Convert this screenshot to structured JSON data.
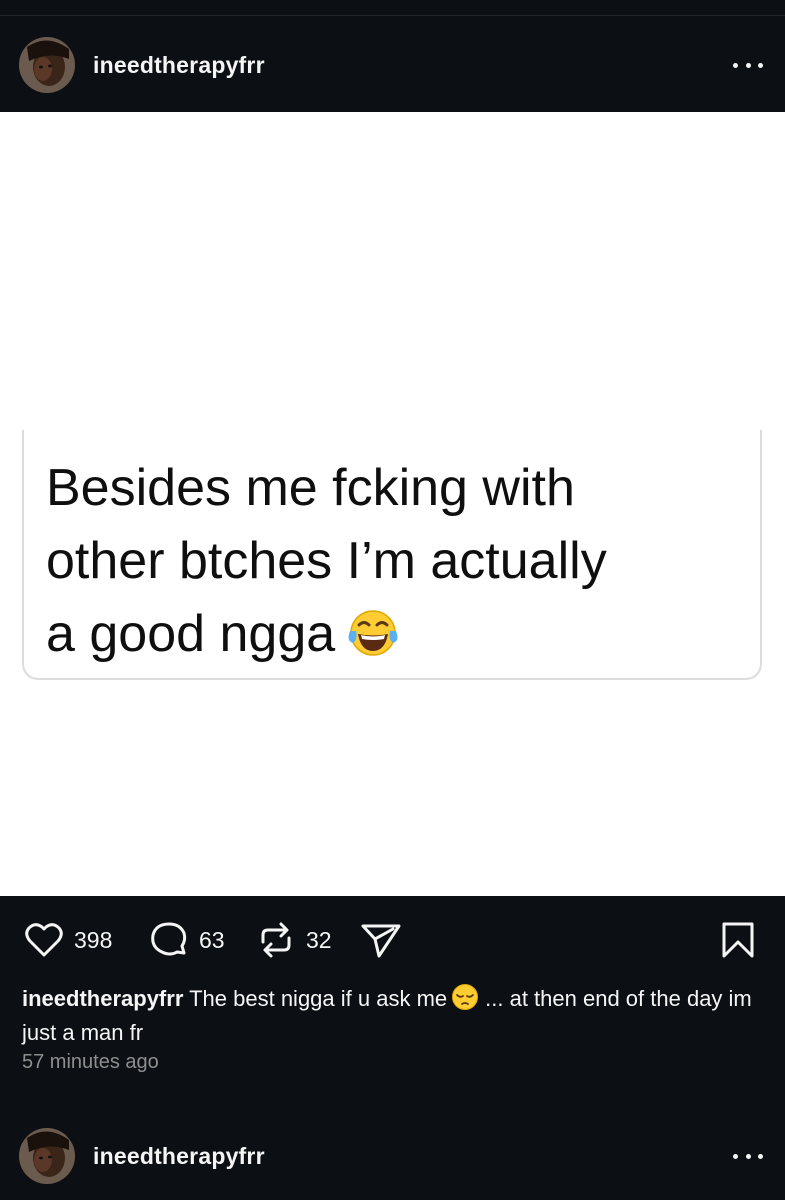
{
  "post": {
    "username": "ineedtherapyfrr",
    "image_text_lines": [
      "Besides me fcking with",
      "other btches I’m actually",
      "a good ngga"
    ],
    "image_emoji": "face-with-tears-of-joy",
    "likes": "398",
    "comments": "63",
    "reposts": "32",
    "caption_user": "ineedtherapyfrr",
    "caption_text_before_emoji": "The best nigga if u ask me",
    "caption_emoji": "pensive-face",
    "caption_text_after_emoji": "... at then end of the day im just a man fr",
    "timestamp": "57 minutes ago"
  },
  "next_post": {
    "username": "ineedtherapyfrr"
  },
  "icons": {
    "like": "heart-icon",
    "comment": "comment-icon",
    "repost": "repost-icon",
    "share": "send-icon",
    "save": "bookmark-icon",
    "more": "more-horizontal-icon"
  },
  "colors": {
    "background": "#0c1014",
    "text": "#f5f5f5",
    "muted": "#8e8e8e"
  }
}
